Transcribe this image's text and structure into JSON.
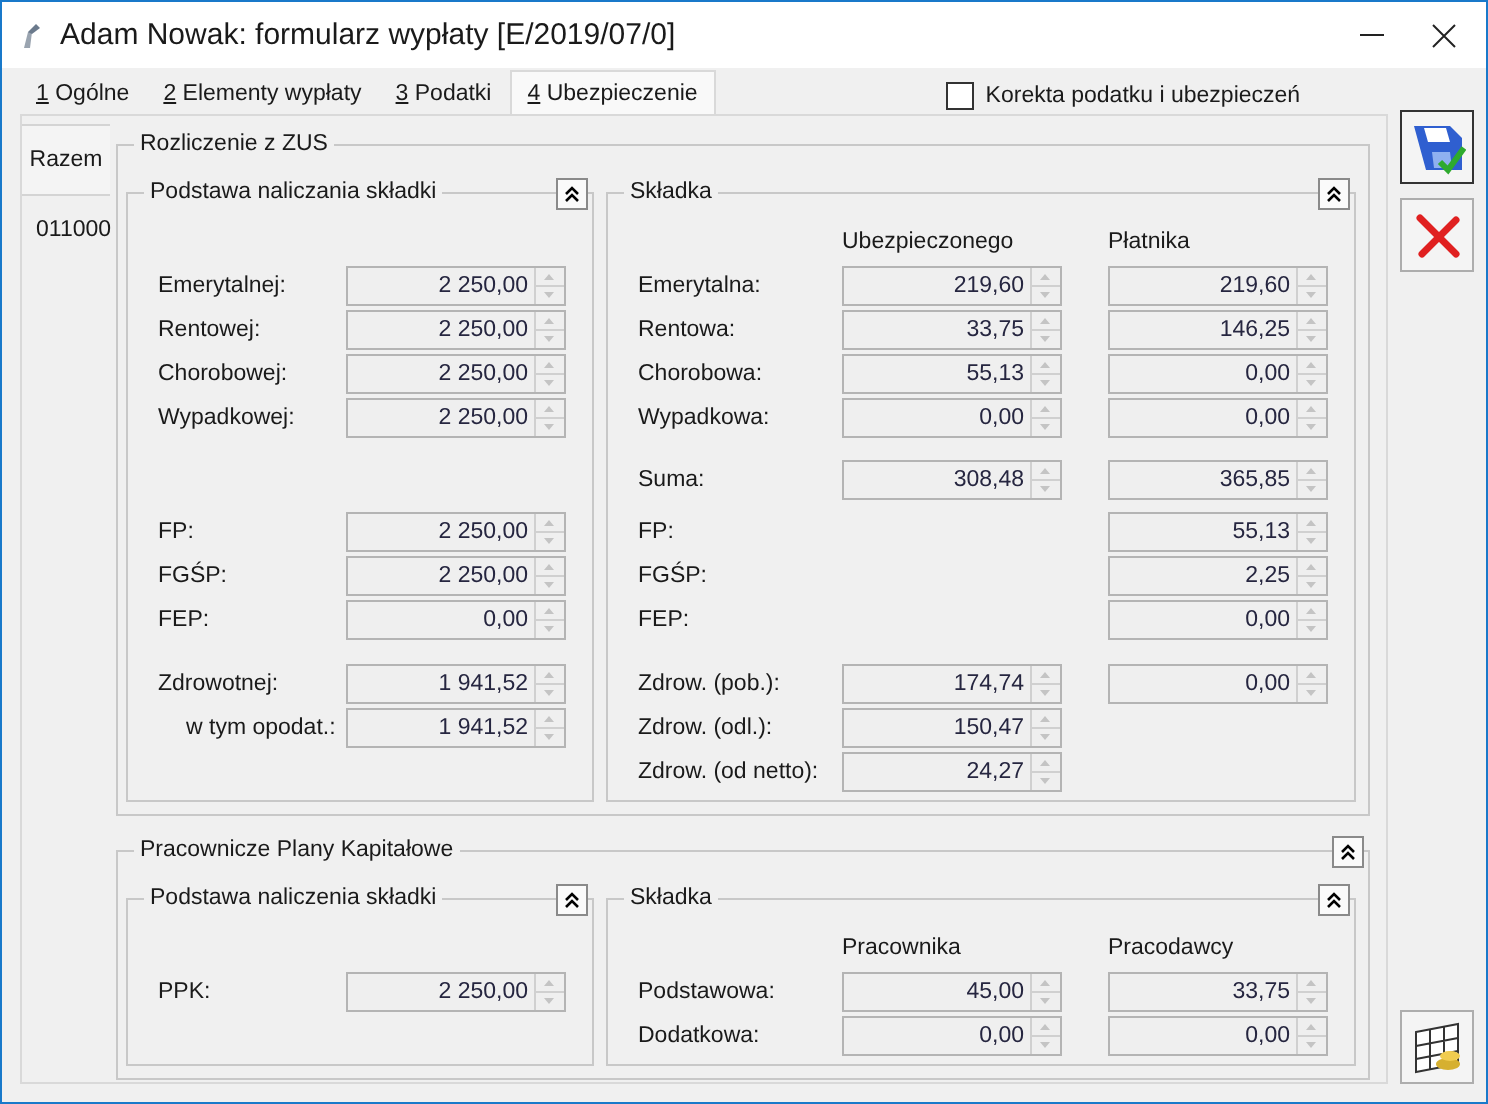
{
  "window": {
    "title": "Adam Nowak: formularz wypłaty [E/2019/07/0]"
  },
  "tabs": [
    {
      "key": "1",
      "label": "Ogólne",
      "selected": false
    },
    {
      "key": "2",
      "label": "Elementy wypłaty",
      "selected": false
    },
    {
      "key": "3",
      "label": "Podatki",
      "selected": false
    },
    {
      "key": "4",
      "label": "Ubezpieczenie",
      "selected": true
    }
  ],
  "correction_checkbox": {
    "label": "Korekta podatku i ubezpieczeń",
    "checked": false
  },
  "side_tabs": [
    {
      "label": "Razem",
      "selected": true
    }
  ],
  "side_code": "011000",
  "groups": [
    {
      "title": "Rozliczenie z ZUS",
      "collapsible": false,
      "base": {
        "title": "Podstawa naliczania składki",
        "collapsible": true,
        "sections": [
          [
            {
              "kind": "main",
              "label": "Emerytalnej:",
              "value": "2 250,00"
            },
            {
              "kind": "main",
              "label": "Rentowej:",
              "value": "2 250,00"
            },
            {
              "kind": "main",
              "label": "Chorobowej:",
              "value": "2 250,00"
            },
            {
              "kind": "main",
              "label": "Wypadkowej:",
              "value": "2 250,00"
            }
          ],
          [
            {
              "kind": "main",
              "label": "FP:",
              "value": "2 250,00"
            },
            {
              "kind": "main",
              "label": "FGŚP:",
              "value": "2 250,00"
            },
            {
              "kind": "main",
              "label": "FEP:",
              "value": "0,00"
            }
          ],
          [
            {
              "kind": "main",
              "label": "Zdrowotnej:",
              "value": "1 941,52"
            },
            {
              "kind": "sub",
              "label": "w tym opodat.:",
              "value": "1 941,52"
            }
          ]
        ]
      },
      "contribution": {
        "title": "Składka",
        "collapsible": true,
        "columns": [
          "Ubezpieczonego",
          "Płatnika"
        ],
        "sections": [
          [
            {
              "label": "Emerytalna:",
              "value_1": "219,60",
              "value_2": "219,60"
            },
            {
              "label": "Rentowa:",
              "value_1": "33,75",
              "value_2": "146,25"
            },
            {
              "label": "Chorobowa:",
              "value_1": "55,13",
              "value_2": "0,00"
            },
            {
              "label": "Wypadkowa:",
              "value_1": "0,00",
              "value_2": "0,00"
            }
          ],
          [
            {
              "label": "Suma:",
              "value_1": "308,48",
              "value_2": "365,85"
            }
          ],
          [
            {
              "label": "FP:",
              "value_2": "55,13"
            },
            {
              "label": "FGŚP:",
              "value_2": "2,25"
            },
            {
              "label": "FEP:",
              "value_2": "0,00"
            }
          ],
          [
            {
              "label": "Zdrow. (pob.):",
              "value_1": "174,74",
              "value_2": "0,00"
            },
            {
              "label": "Zdrow. (odl.):",
              "value_1": "150,47"
            },
            {
              "label": "Zdrow. (od netto):",
              "value_1": "24,27"
            }
          ]
        ]
      }
    },
    {
      "title": "Pracownicze Plany Kapitałowe",
      "collapsible": true,
      "base": {
        "title": "Podstawa naliczenia składki",
        "collapsible": true,
        "sections": [
          [
            {
              "kind": "main",
              "label": "PPK:",
              "value": "2 250,00"
            }
          ]
        ]
      },
      "contribution": {
        "title": "Składka",
        "collapsible": true,
        "columns": [
          "Pracownika",
          "Pracodawcy"
        ],
        "sections": [
          [
            {
              "label": "Podstawowa:",
              "value_1": "45,00",
              "value_2": "33,75"
            },
            {
              "label": "Dodatkowa:",
              "value_1": "0,00",
              "value_2": "0,00"
            }
          ]
        ]
      }
    }
  ]
}
